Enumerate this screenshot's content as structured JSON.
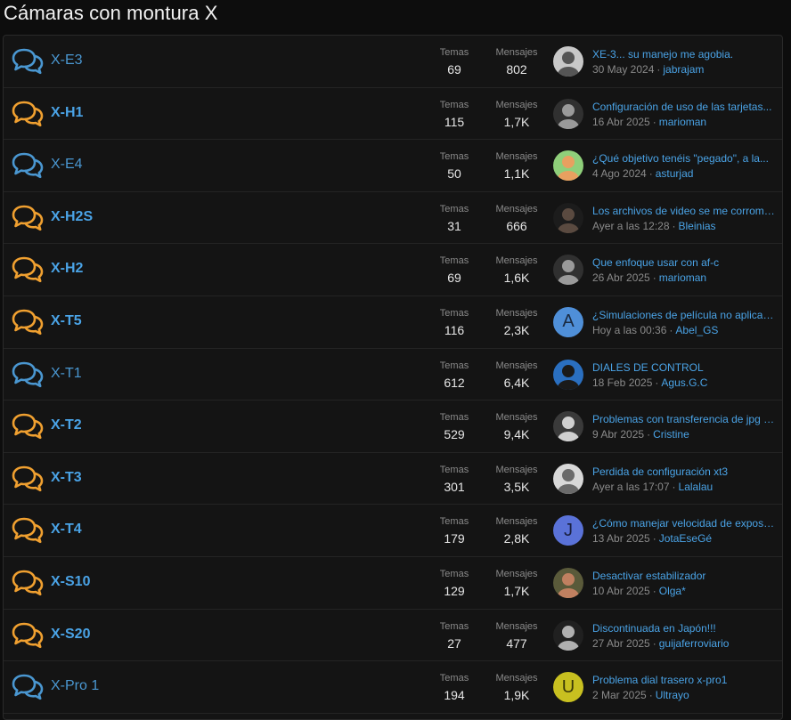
{
  "page_title": "Cámaras con montura X",
  "labels": {
    "temas": "Temas",
    "mensajes": "Mensajes",
    "sep": "·"
  },
  "colors": {
    "unread_icon": "#f0a030",
    "read_icon": "#4a97d1",
    "link": "#4aa3e6"
  },
  "forums": [
    {
      "name": "X-E3",
      "unread": false,
      "temas": "69",
      "mensajes": "802",
      "latest_title": "XE-3... su manejo me agobia.",
      "latest_date": "30 May 2024",
      "latest_user": "jabrajam",
      "avatar": {
        "type": "photo",
        "bg": "#c8c8c8",
        "fg": "#555555",
        "letter": ""
      }
    },
    {
      "name": "X-H1",
      "unread": true,
      "temas": "115",
      "mensajes": "1,7K",
      "latest_title": "Configuración de uso de las tarjetas...",
      "latest_date": "16 Abr 2025",
      "latest_user": "marioman",
      "avatar": {
        "type": "photo",
        "bg": "#303030",
        "fg": "#9a9a9a",
        "letter": ""
      }
    },
    {
      "name": "X-E4",
      "unread": false,
      "temas": "50",
      "mensajes": "1,1K",
      "latest_title": "¿Qué objetivo tenéis \"pegado\", a la...",
      "latest_date": "4 Ago 2024",
      "latest_user": "asturjad",
      "avatar": {
        "type": "photo",
        "bg": "#8fcf7a",
        "fg": "#e8a060",
        "letter": ""
      }
    },
    {
      "name": "X-H2S",
      "unread": true,
      "temas": "31",
      "mensajes": "666",
      "latest_title": "Los archivos de video se me corrompen...",
      "latest_date": "Ayer a las 12:28",
      "latest_user": "Bleinias",
      "avatar": {
        "type": "photo",
        "bg": "#1c1c1c",
        "fg": "#5a4a40",
        "letter": ""
      }
    },
    {
      "name": "X-H2",
      "unread": true,
      "temas": "69",
      "mensajes": "1,6K",
      "latest_title": "Que enfoque usar con af-c",
      "latest_date": "26 Abr 2025",
      "latest_user": "marioman",
      "avatar": {
        "type": "photo",
        "bg": "#303030",
        "fg": "#9a9a9a",
        "letter": ""
      }
    },
    {
      "name": "X-T5",
      "unread": true,
      "temas": "116",
      "mensajes": "2,3K",
      "latest_title": "¿Simulaciones de película no aplicadas...",
      "latest_date": "Hoy a las 00:36",
      "latest_user": "Abel_GS",
      "avatar": {
        "type": "letter",
        "bg": "#4f8fd8",
        "fg": "#1a2a40",
        "letter": "A"
      }
    },
    {
      "name": "X-T1",
      "unread": false,
      "temas": "612",
      "mensajes": "6,4K",
      "latest_title": "DIALES DE CONTROL",
      "latest_date": "18 Feb 2025",
      "latest_user": "Agus.G.C",
      "avatar": {
        "type": "photo",
        "bg": "#2a6fc0",
        "fg": "#1a1a1a",
        "letter": ""
      }
    },
    {
      "name": "X-T2",
      "unread": true,
      "temas": "529",
      "mensajes": "9,4K",
      "latest_title": "Problemas con transferencia de jpg a...",
      "latest_date": "9 Abr 2025",
      "latest_user": "Cristine",
      "avatar": {
        "type": "photo",
        "bg": "#3a3a3a",
        "fg": "#d0d0d0",
        "letter": ""
      }
    },
    {
      "name": "X-T3",
      "unread": true,
      "temas": "301",
      "mensajes": "3,5K",
      "latest_title": "Perdida de configuración xt3",
      "latest_date": "Ayer a las 17:07",
      "latest_user": "Lalalau",
      "avatar": {
        "type": "photo",
        "bg": "#d8d8d8",
        "fg": "#6a6a6a",
        "letter": ""
      }
    },
    {
      "name": "X-T4",
      "unread": true,
      "temas": "179",
      "mensajes": "2,8K",
      "latest_title": "¿Cómo manejar velocidad de exposición...",
      "latest_date": "13 Abr 2025",
      "latest_user": "JotaEseGé",
      "avatar": {
        "type": "letter",
        "bg": "#5a72d8",
        "fg": "#1a2040",
        "letter": "J"
      }
    },
    {
      "name": "X-S10",
      "unread": true,
      "temas": "129",
      "mensajes": "1,7K",
      "latest_title": "Desactivar estabilizador",
      "latest_date": "10 Abr 2025",
      "latest_user": "Olga*",
      "avatar": {
        "type": "photo",
        "bg": "#5a5a3a",
        "fg": "#c08060",
        "letter": ""
      }
    },
    {
      "name": "X-S20",
      "unread": true,
      "temas": "27",
      "mensajes": "477",
      "latest_title": "Discontinuada en Japón!!!",
      "latest_date": "27 Abr 2025",
      "latest_user": "guijaferroviario",
      "avatar": {
        "type": "photo",
        "bg": "#202020",
        "fg": "#b0b0b0",
        "letter": ""
      }
    },
    {
      "name": "X-Pro 1",
      "unread": false,
      "temas": "194",
      "mensajes": "1,9K",
      "latest_title": "Problema dial trasero x-pro1",
      "latest_date": "2 Mar 2025",
      "latest_user": "Ultrayo",
      "avatar": {
        "type": "letter",
        "bg": "#c8c020",
        "fg": "#3a3808",
        "letter": "U"
      }
    }
  ]
}
